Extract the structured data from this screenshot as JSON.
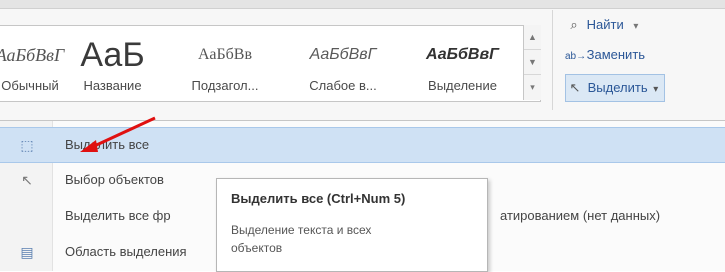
{
  "ribbon": {
    "styles": [
      {
        "sample": "АаБбВвГ",
        "label": "Обычный"
      },
      {
        "sample": "АаБ",
        "label": "Название"
      },
      {
        "sample": "АаБбВв",
        "label": "Подзагол..."
      },
      {
        "sample": "АаБбВвГ",
        "label": "Слабое в..."
      },
      {
        "sample": "АаБбВвГ",
        "label": "Выделение"
      }
    ],
    "find_label": "Найти",
    "replace_label": "Заменить",
    "select_label": "Выделить"
  },
  "menu": {
    "items": [
      {
        "label": "Выделить все",
        "trail": ""
      },
      {
        "label": "Выбор объектов",
        "trail": ""
      },
      {
        "label": "Выделить все фр",
        "trail": "атированием (нет данных)"
      },
      {
        "label": "Область выделения",
        "trail": ""
      }
    ]
  },
  "tooltip": {
    "title": "Выделить все (Ctrl+Num 5)",
    "description": "Выделение текста и всех объектов"
  },
  "colors": {
    "accent": "#2b5797",
    "hover": "#cfe1f4",
    "arrow": "#e01010"
  }
}
